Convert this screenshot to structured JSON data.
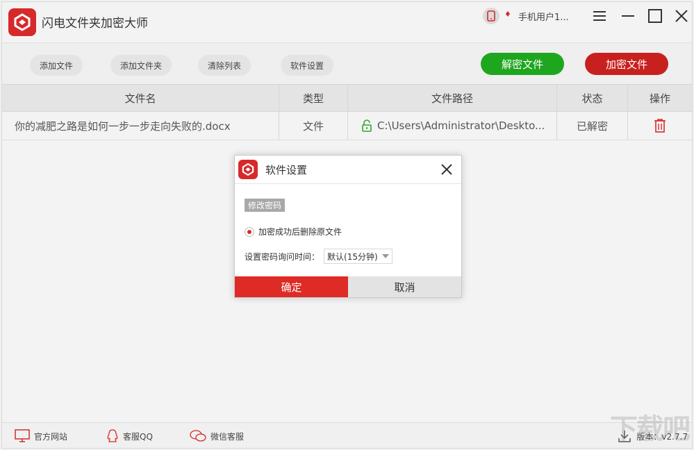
{
  "app": {
    "title": "闪电文件夹加密大师",
    "user": "手机用户1..."
  },
  "toolbar": {
    "add_file": "添加文件",
    "add_folder": "添加文件夹",
    "clear_list": "清除列表",
    "settings": "软件设置",
    "decrypt": "解密文件",
    "encrypt": "加密文件",
    "decrypt_color": "#1fa61f",
    "encrypt_color": "#c8201e"
  },
  "table": {
    "headers": [
      "文件名",
      "类型",
      "文件路径",
      "状态",
      "操作"
    ],
    "rows": [
      {
        "name": "你的减肥之路是如何一步一步走向失败的.docx",
        "type": "文件",
        "path": "C:\\Users\\Administrator\\Deskto...",
        "status": "已解密"
      }
    ]
  },
  "dialog": {
    "title": "软件设置",
    "change_password": "修改密码",
    "delete_option": "加密成功后删除原文件",
    "ask_time_label": "设置密码询问时间：",
    "ask_time_value": "默认(15分钟)",
    "ok": "确定",
    "cancel": "取消"
  },
  "statusbar": {
    "website": "官方网站",
    "qq": "客服QQ",
    "wechat": "微信客服",
    "version": "版本：v2.7.7"
  },
  "watermark": "下载吧"
}
